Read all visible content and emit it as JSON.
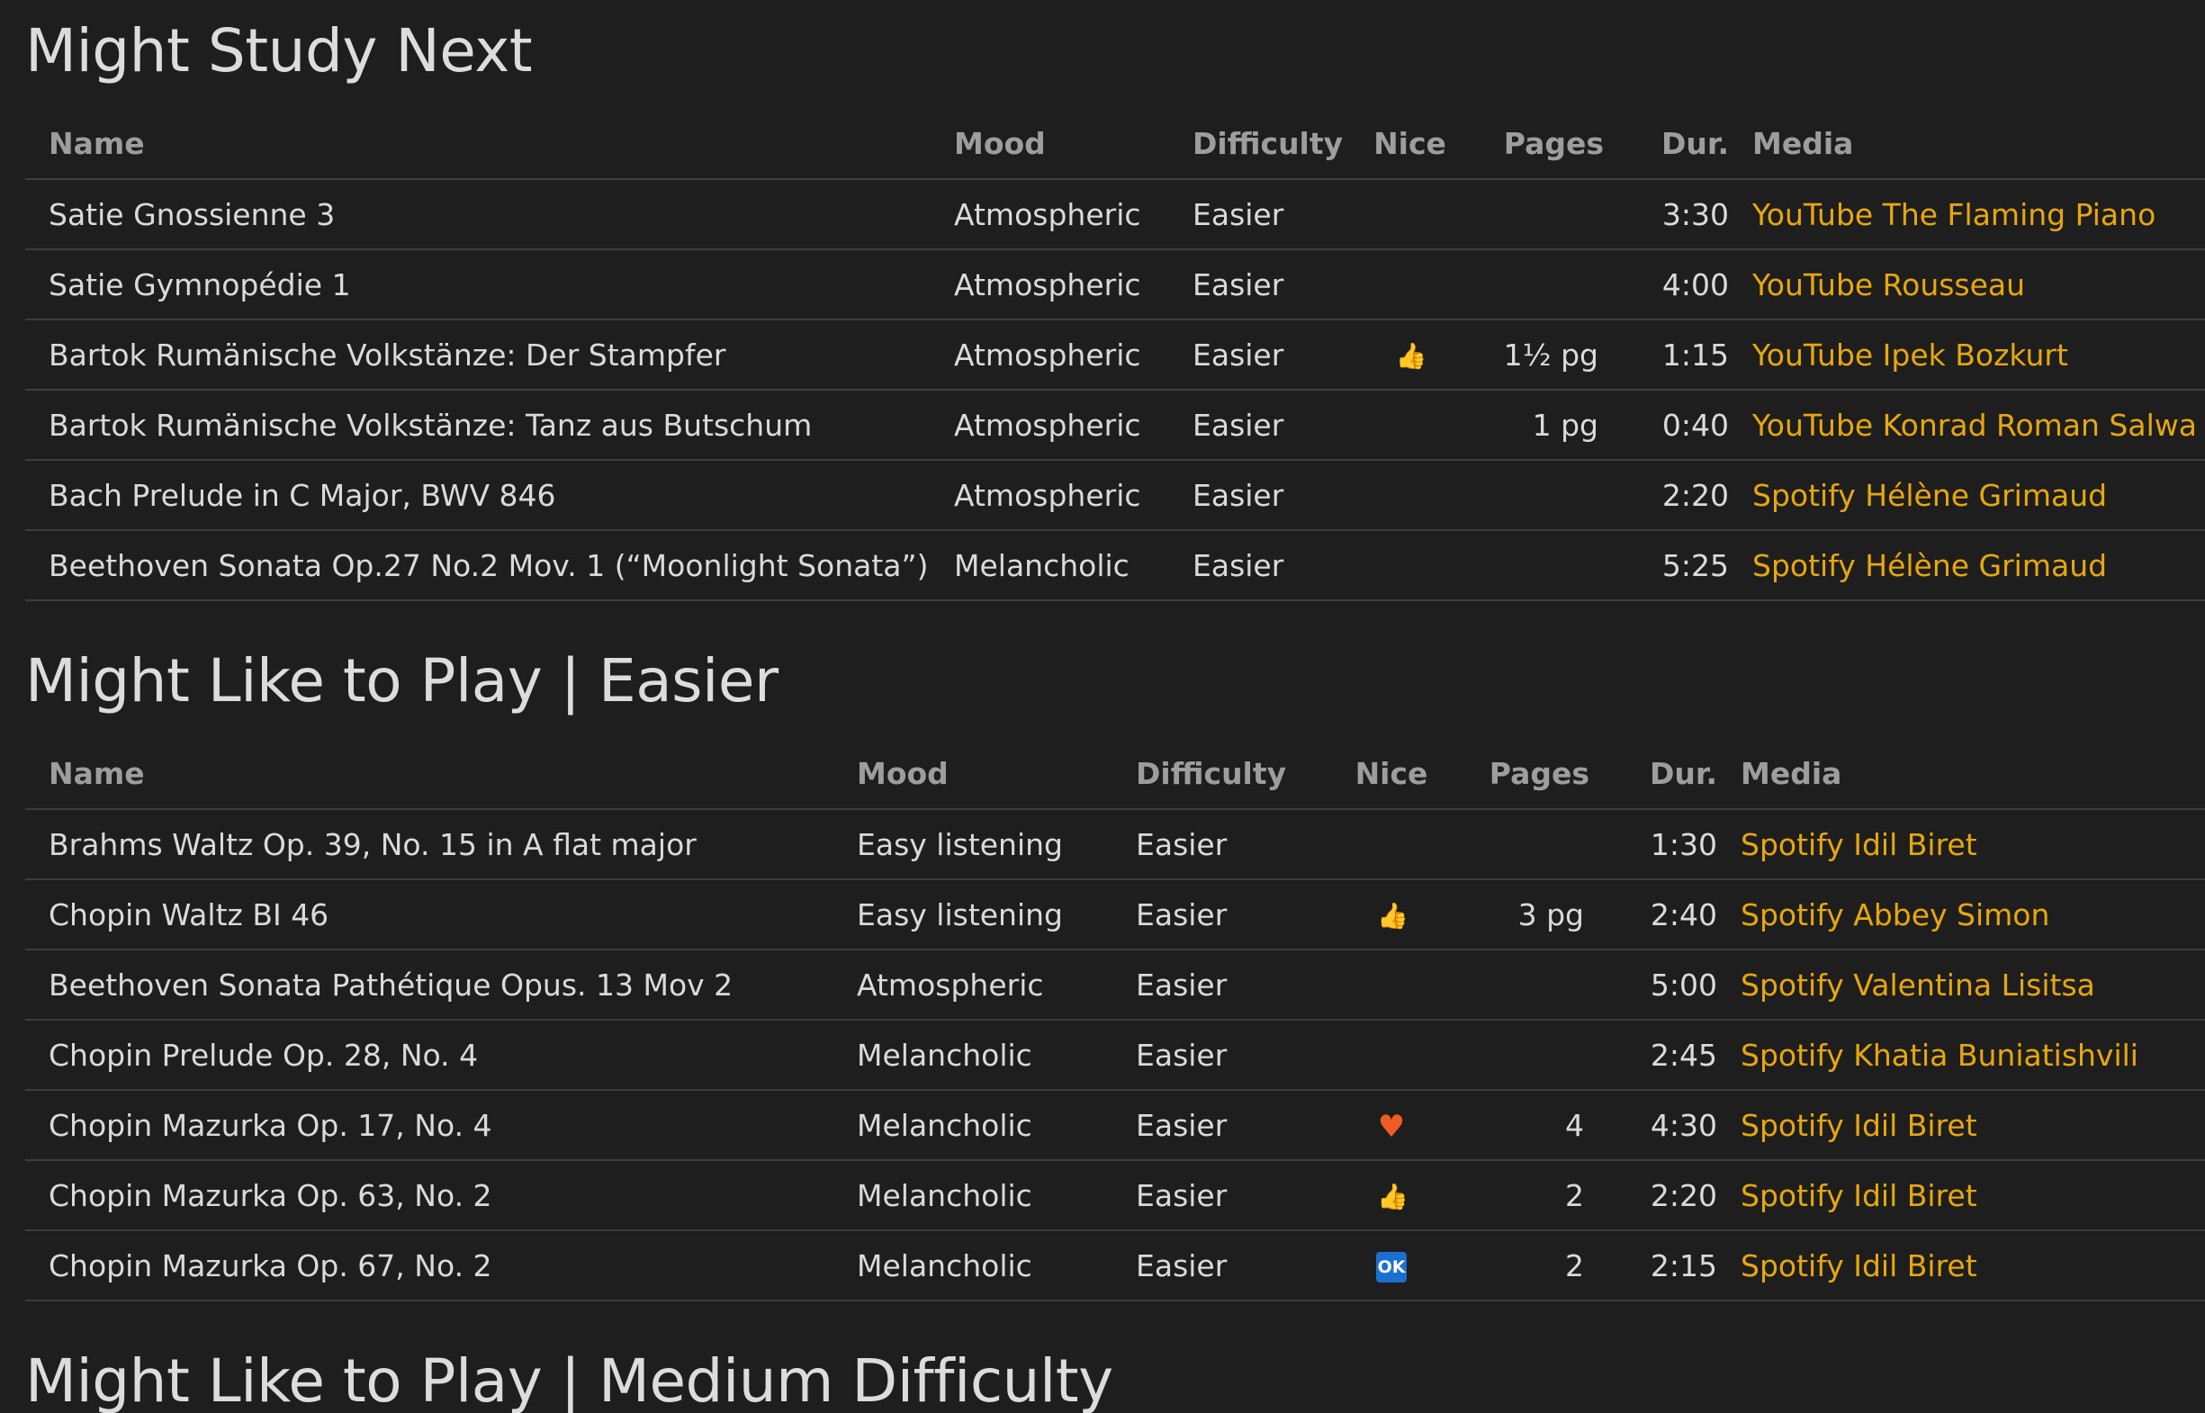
{
  "sections": [
    {
      "title": "Might Study Next",
      "columns": [
        "Name",
        "Mood",
        "Difficulty",
        "Nice",
        "Pages",
        "Dur.",
        "Media"
      ],
      "rows": [
        {
          "name": "Satie Gnossienne 3",
          "mood": "Atmospheric",
          "difficulty": "Easier",
          "nice": "",
          "pages": "",
          "dur": "3:30",
          "media": "YouTube The Flaming Piano"
        },
        {
          "name": "Satie Gymnopédie 1",
          "mood": "Atmospheric",
          "difficulty": "Easier",
          "nice": "",
          "pages": "",
          "dur": "4:00",
          "media": "YouTube Rousseau"
        },
        {
          "name": "Bartok Rumänische Volkstänze: Der Stampfer",
          "mood": "Atmospheric",
          "difficulty": "Easier",
          "nice": "thumbs-up",
          "pages": "1½ pg",
          "dur": "1:15",
          "media": "YouTube Ipek Bozkurt"
        },
        {
          "name": "Bartok Rumänische Volkstänze: Tanz aus Butschum",
          "mood": "Atmospheric",
          "difficulty": "Easier",
          "nice": "",
          "pages": "1 pg",
          "dur": "0:40",
          "media": "YouTube Konrad Roman Salwa"
        },
        {
          "name": "Bach Prelude in C Major, BWV 846",
          "mood": "Atmospheric",
          "difficulty": "Easier",
          "nice": "",
          "pages": "",
          "dur": "2:20",
          "media": "Spotify Hélène Grimaud"
        },
        {
          "name": "Beethoven Sonata Op.27 No.2 Mov. 1 (“Moonlight Sonata”)",
          "mood": "Melancholic",
          "difficulty": "Easier",
          "nice": "",
          "pages": "",
          "dur": "5:25",
          "media": "Spotify Hélène Grimaud"
        }
      ]
    },
    {
      "title": "Might Like to Play | Easier",
      "columns": [
        "Name",
        "Mood",
        "Difficulty",
        "Nice",
        "Pages",
        "Dur.",
        "Media"
      ],
      "rows": [
        {
          "name": "Brahms Waltz Op. 39, No. 15 in A flat major",
          "mood": "Easy listening",
          "difficulty": "Easier",
          "nice": "",
          "pages": "",
          "dur": "1:30",
          "media": "Spotify Idil Biret"
        },
        {
          "name": "Chopin Waltz BI 46",
          "mood": "Easy listening",
          "difficulty": "Easier",
          "nice": "thumbs-up",
          "pages": "3 pg",
          "dur": "2:40",
          "media": "Spotify Abbey Simon"
        },
        {
          "name": "Beethoven Sonata Pathétique Opus. 13 Mov 2",
          "mood": "Atmospheric",
          "difficulty": "Easier",
          "nice": "",
          "pages": "",
          "dur": "5:00",
          "media": "Spotify Valentina Lisitsa"
        },
        {
          "name": "Chopin Prelude Op. 28, No. 4",
          "mood": "Melancholic",
          "difficulty": "Easier",
          "nice": "",
          "pages": "",
          "dur": "2:45",
          "media": "Spotify Khatia Buniatishvili"
        },
        {
          "name": "Chopin Mazurka Op. 17, No. 4",
          "mood": "Melancholic",
          "difficulty": "Easier",
          "nice": "heart",
          "pages": "4",
          "dur": "4:30",
          "media": "Spotify Idil Biret"
        },
        {
          "name": "Chopin Mazurka Op. 63, No. 2",
          "mood": "Melancholic",
          "difficulty": "Easier",
          "nice": "thumbs-up",
          "pages": "2",
          "dur": "2:20",
          "media": "Spotify Idil Biret"
        },
        {
          "name": "Chopin Mazurka Op. 67, No. 2",
          "mood": "Melancholic",
          "difficulty": "Easier",
          "nice": "ok",
          "pages": "2",
          "dur": "2:15",
          "media": "Spotify Idil Biret"
        }
      ]
    },
    {
      "title": "Might Like to Play | Medium Difficulty"
    }
  ],
  "icons": {
    "thumbs-up": {
      "glyph": "👍",
      "color": "#f2b51e"
    },
    "heart": {
      "glyph": "♥",
      "color": "#f05a24"
    },
    "ok": {
      "glyph": "OK",
      "color": "#1b6fd1"
    }
  },
  "colors": {
    "background": "#1e1e1e",
    "text": "#dadada",
    "header_text": "#9d9d9d",
    "link": "#e6a70f",
    "row_border": "#3d3d3d"
  }
}
